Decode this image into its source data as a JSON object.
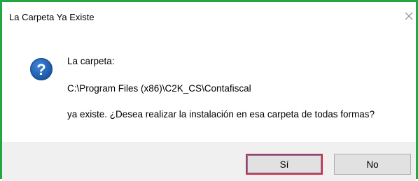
{
  "dialog": {
    "title": "La Carpeta Ya Existe",
    "close_icon": "close-icon",
    "question_icon": "question-icon",
    "line1": "La carpeta:",
    "path": "C:\\Program Files (x86)\\C2K_CS\\Contafiscal",
    "line3": "ya existe. ¿Desea realizar la instalación en esa carpeta de todas formas?",
    "buttons": {
      "yes_label": "Sí",
      "no_label": "No"
    }
  },
  "colors": {
    "highlight_border": "#22a842",
    "focus_outline": "#e02a30",
    "icon_blue": "#1f5fb4"
  }
}
